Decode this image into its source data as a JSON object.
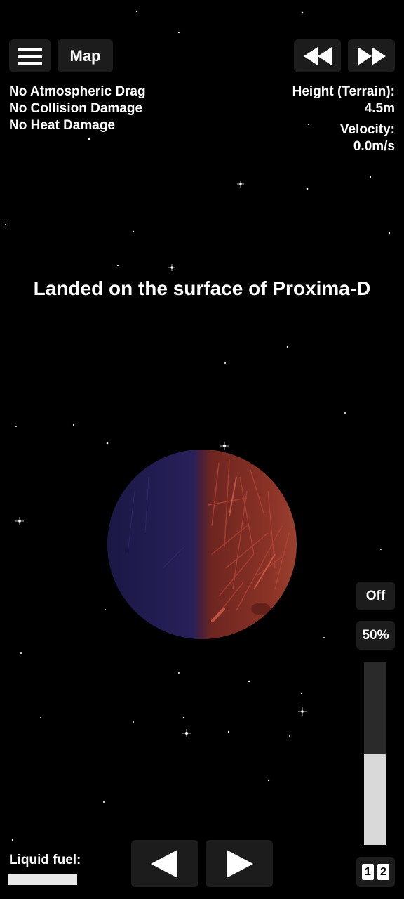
{
  "toolbar": {
    "map_label": "Map",
    "menu_icon": "hamburger-menu-icon",
    "rewind_icon": "rewind-icon",
    "fast_forward_icon": "fast-forward-icon"
  },
  "cheats": [
    "No Atmospheric Drag",
    "No Collision Damage",
    "No Heat Damage"
  ],
  "telemetry": {
    "height_label": "Height (Terrain):",
    "height_value": "4.5m",
    "velocity_label": "Velocity:",
    "velocity_value": "0.0m/s"
  },
  "status_message": "Landed on the surface of Proxima-D",
  "planet": {
    "dark_side_color": "#1e1a4a",
    "lit_side_color": "#7a2a22",
    "streak_color": "#c84a3a"
  },
  "throttle": {
    "off_label": "Off",
    "percent_label": "50%",
    "level": 0.5
  },
  "fuel": {
    "label": "Liquid fuel:",
    "level": 1.0
  },
  "controls": {
    "left_icon": "rotate-left-arrow-icon",
    "right_icon": "rotate-right-arrow-icon"
  },
  "stage": {
    "first": "1",
    "second": "2"
  }
}
